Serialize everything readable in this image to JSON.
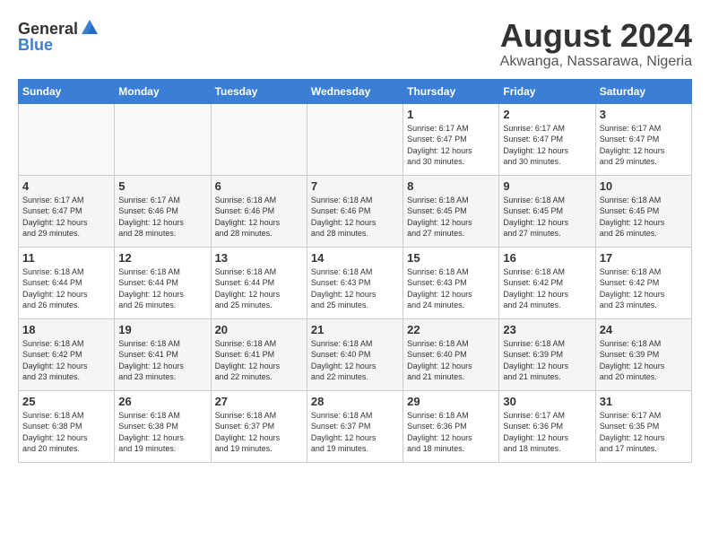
{
  "header": {
    "logo_general": "General",
    "logo_blue": "Blue",
    "title": "August 2024",
    "subtitle": "Akwanga, Nassarawa, Nigeria"
  },
  "days_of_week": [
    "Sunday",
    "Monday",
    "Tuesday",
    "Wednesday",
    "Thursday",
    "Friday",
    "Saturday"
  ],
  "weeks": [
    [
      {
        "day": "",
        "info": ""
      },
      {
        "day": "",
        "info": ""
      },
      {
        "day": "",
        "info": ""
      },
      {
        "day": "",
        "info": ""
      },
      {
        "day": "1",
        "info": "Sunrise: 6:17 AM\nSunset: 6:47 PM\nDaylight: 12 hours\nand 30 minutes."
      },
      {
        "day": "2",
        "info": "Sunrise: 6:17 AM\nSunset: 6:47 PM\nDaylight: 12 hours\nand 30 minutes."
      },
      {
        "day": "3",
        "info": "Sunrise: 6:17 AM\nSunset: 6:47 PM\nDaylight: 12 hours\nand 29 minutes."
      }
    ],
    [
      {
        "day": "4",
        "info": "Sunrise: 6:17 AM\nSunset: 6:47 PM\nDaylight: 12 hours\nand 29 minutes."
      },
      {
        "day": "5",
        "info": "Sunrise: 6:17 AM\nSunset: 6:46 PM\nDaylight: 12 hours\nand 28 minutes."
      },
      {
        "day": "6",
        "info": "Sunrise: 6:18 AM\nSunset: 6:46 PM\nDaylight: 12 hours\nand 28 minutes."
      },
      {
        "day": "7",
        "info": "Sunrise: 6:18 AM\nSunset: 6:46 PM\nDaylight: 12 hours\nand 28 minutes."
      },
      {
        "day": "8",
        "info": "Sunrise: 6:18 AM\nSunset: 6:45 PM\nDaylight: 12 hours\nand 27 minutes."
      },
      {
        "day": "9",
        "info": "Sunrise: 6:18 AM\nSunset: 6:45 PM\nDaylight: 12 hours\nand 27 minutes."
      },
      {
        "day": "10",
        "info": "Sunrise: 6:18 AM\nSunset: 6:45 PM\nDaylight: 12 hours\nand 26 minutes."
      }
    ],
    [
      {
        "day": "11",
        "info": "Sunrise: 6:18 AM\nSunset: 6:44 PM\nDaylight: 12 hours\nand 26 minutes."
      },
      {
        "day": "12",
        "info": "Sunrise: 6:18 AM\nSunset: 6:44 PM\nDaylight: 12 hours\nand 26 minutes."
      },
      {
        "day": "13",
        "info": "Sunrise: 6:18 AM\nSunset: 6:44 PM\nDaylight: 12 hours\nand 25 minutes."
      },
      {
        "day": "14",
        "info": "Sunrise: 6:18 AM\nSunset: 6:43 PM\nDaylight: 12 hours\nand 25 minutes."
      },
      {
        "day": "15",
        "info": "Sunrise: 6:18 AM\nSunset: 6:43 PM\nDaylight: 12 hours\nand 24 minutes."
      },
      {
        "day": "16",
        "info": "Sunrise: 6:18 AM\nSunset: 6:42 PM\nDaylight: 12 hours\nand 24 minutes."
      },
      {
        "day": "17",
        "info": "Sunrise: 6:18 AM\nSunset: 6:42 PM\nDaylight: 12 hours\nand 23 minutes."
      }
    ],
    [
      {
        "day": "18",
        "info": "Sunrise: 6:18 AM\nSunset: 6:42 PM\nDaylight: 12 hours\nand 23 minutes."
      },
      {
        "day": "19",
        "info": "Sunrise: 6:18 AM\nSunset: 6:41 PM\nDaylight: 12 hours\nand 23 minutes."
      },
      {
        "day": "20",
        "info": "Sunrise: 6:18 AM\nSunset: 6:41 PM\nDaylight: 12 hours\nand 22 minutes."
      },
      {
        "day": "21",
        "info": "Sunrise: 6:18 AM\nSunset: 6:40 PM\nDaylight: 12 hours\nand 22 minutes."
      },
      {
        "day": "22",
        "info": "Sunrise: 6:18 AM\nSunset: 6:40 PM\nDaylight: 12 hours\nand 21 minutes."
      },
      {
        "day": "23",
        "info": "Sunrise: 6:18 AM\nSunset: 6:39 PM\nDaylight: 12 hours\nand 21 minutes."
      },
      {
        "day": "24",
        "info": "Sunrise: 6:18 AM\nSunset: 6:39 PM\nDaylight: 12 hours\nand 20 minutes."
      }
    ],
    [
      {
        "day": "25",
        "info": "Sunrise: 6:18 AM\nSunset: 6:38 PM\nDaylight: 12 hours\nand 20 minutes."
      },
      {
        "day": "26",
        "info": "Sunrise: 6:18 AM\nSunset: 6:38 PM\nDaylight: 12 hours\nand 19 minutes."
      },
      {
        "day": "27",
        "info": "Sunrise: 6:18 AM\nSunset: 6:37 PM\nDaylight: 12 hours\nand 19 minutes."
      },
      {
        "day": "28",
        "info": "Sunrise: 6:18 AM\nSunset: 6:37 PM\nDaylight: 12 hours\nand 19 minutes."
      },
      {
        "day": "29",
        "info": "Sunrise: 6:18 AM\nSunset: 6:36 PM\nDaylight: 12 hours\nand 18 minutes."
      },
      {
        "day": "30",
        "info": "Sunrise: 6:17 AM\nSunset: 6:36 PM\nDaylight: 12 hours\nand 18 minutes."
      },
      {
        "day": "31",
        "info": "Sunrise: 6:17 AM\nSunset: 6:35 PM\nDaylight: 12 hours\nand 17 minutes."
      }
    ]
  ]
}
